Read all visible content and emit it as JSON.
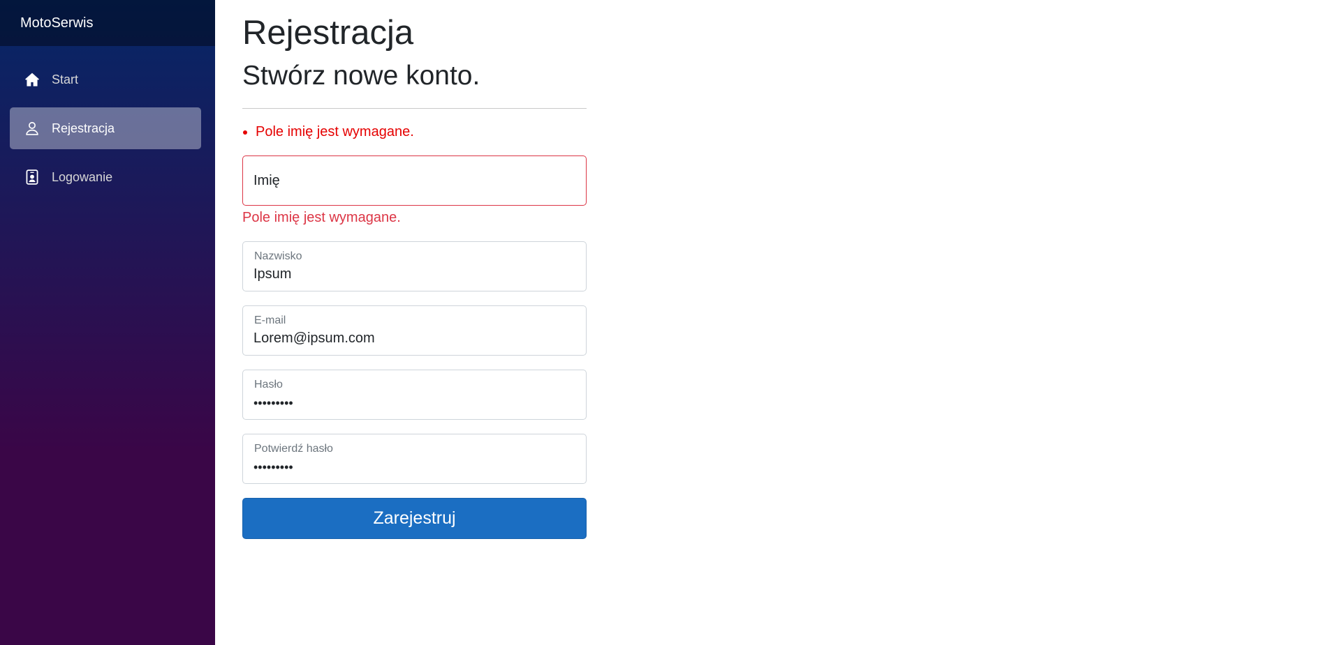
{
  "brand": {
    "name": "MotoSerwis"
  },
  "sidebar": {
    "items": [
      {
        "label": "Start",
        "icon": "home-icon",
        "active": false
      },
      {
        "label": "Rejestracja",
        "icon": "person-icon",
        "active": true
      },
      {
        "label": "Logowanie",
        "icon": "person-badge-icon",
        "active": false
      }
    ]
  },
  "page": {
    "title": "Rejestracja",
    "subtitle": "Stwórz nowe konto."
  },
  "validation_summary": [
    "Pole imię jest wymagane."
  ],
  "form": {
    "first_name": {
      "placeholder": "Imię",
      "value": "",
      "error": "Pole imię jest wymagane."
    },
    "last_name": {
      "label": "Nazwisko",
      "value": "Ipsum"
    },
    "email": {
      "label": "E-mail",
      "value": "Lorem@ipsum.com"
    },
    "password": {
      "label": "Hasło",
      "value": "•••••••••"
    },
    "confirm_password": {
      "label": "Potwierdź hasło",
      "value": "•••••••••"
    },
    "submit_label": "Zarejestruj"
  },
  "colors": {
    "sidebar_gradient_top": "#052767",
    "sidebar_gradient_bottom": "#3a0647",
    "primary_button": "#1b6ec2",
    "error": "#dc3545",
    "summary_error": "#e50000"
  }
}
